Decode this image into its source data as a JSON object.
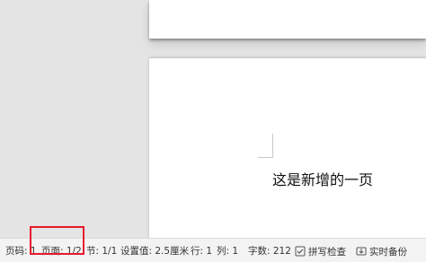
{
  "document": {
    "body_text": "这是新增的一页"
  },
  "statusbar": {
    "page_number": "页码: 1",
    "page": "页面: 1/2",
    "section": "节: 1/1",
    "setting_value": "设置值: 2.5厘米",
    "row": "行: 1",
    "column": "列: 1",
    "word_count": "字数: 212",
    "spell_check": "拼写检查",
    "realtime_backup": "实时备份"
  },
  "colors": {
    "highlight": "#e8192c"
  }
}
